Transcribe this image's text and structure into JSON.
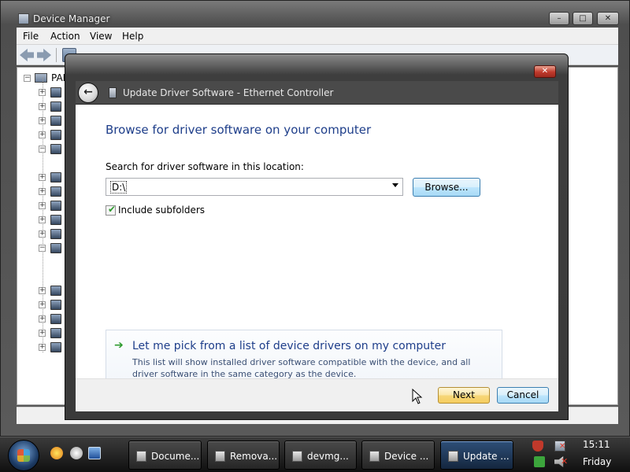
{
  "device_manager": {
    "title": "Device Manager",
    "menu": [
      "File",
      "Action",
      "View",
      "Help"
    ],
    "tree_root_label": "PAF",
    "caption_buttons": {
      "minimize": "–",
      "maximize": "□",
      "close": "✕"
    }
  },
  "dialog": {
    "close_glyph": "✕",
    "header_title": "Update Driver Software - Ethernet Controller",
    "back_glyph": "←",
    "heading": "Browse for driver software on your computer",
    "search_label": "Search for driver software in this location:",
    "path_value": "D:\\",
    "browse_label": "Browse...",
    "include_subfolders_label": "Include subfolders",
    "include_subfolders_checked": true,
    "pick_arrow": "➔",
    "pick_title": "Let me pick from a list of device drivers on my computer",
    "pick_description": "This list will show installed driver software compatible with the device, and all driver software in the same category as the device.",
    "next_label": "Next",
    "cancel_label": "Cancel"
  },
  "taskbar": {
    "tasks": [
      {
        "label": "Docume...",
        "active": false
      },
      {
        "label": "Remova...",
        "active": false
      },
      {
        "label": "devmg...",
        "active": false
      },
      {
        "label": "Device ...",
        "active": false
      },
      {
        "label": "Update ...",
        "active": true
      }
    ],
    "clock_time": "15:11",
    "clock_day": "Friday"
  }
}
